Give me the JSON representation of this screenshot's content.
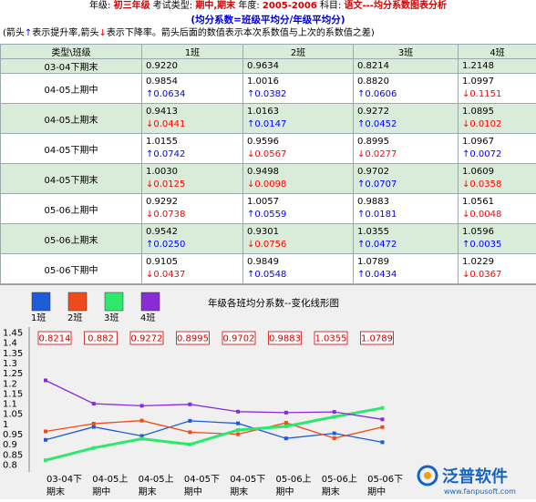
{
  "header": {
    "grade_label": "年级:",
    "grade_value": "初三年级",
    "exam_type_label": "考试类型:",
    "exam_type_value": "期中,期末",
    "year_label": "年度:",
    "year_value": "2005-2006",
    "subject_label": "科目:",
    "subject_value": "语文---均分系数图表分析",
    "formula": "(均分系数=班级平均分/年级平均分)",
    "legend_prefix": "(箭头",
    "legend_up": "↑",
    "legend_up_text": "表示提升率,箭头",
    "legend_down": "↓",
    "legend_down_text": "表示下降率。箭头后面的数值表示本次系数值与上次的系数值之差)"
  },
  "table": {
    "headers": [
      "类型\\班级",
      "1班",
      "2班",
      "3班",
      "4班"
    ],
    "rows": [
      {
        "type": "03-04下期末",
        "cells": [
          {
            "v": "0.9220"
          },
          {
            "v": "0.9634"
          },
          {
            "v": "0.8214"
          },
          {
            "v": "1.2148"
          }
        ]
      },
      {
        "type": "04-05上期中",
        "cells": [
          {
            "v": "0.9854",
            "a": "↑",
            "d": "0.0634"
          },
          {
            "v": "1.0016",
            "a": "↑",
            "d": "0.0382"
          },
          {
            "v": "0.8820",
            "a": "↑",
            "d": "0.0606"
          },
          {
            "v": "1.0997",
            "a": "↓",
            "d": "0.1151"
          }
        ]
      },
      {
        "type": "04-05上期末",
        "cells": [
          {
            "v": "0.9413",
            "a": "↓",
            "d": "0.0441"
          },
          {
            "v": "1.0163",
            "a": "↑",
            "d": "0.0147"
          },
          {
            "v": "0.9272",
            "a": "↑",
            "d": "0.0452"
          },
          {
            "v": "1.0895",
            "a": "↓",
            "d": "0.0102"
          }
        ]
      },
      {
        "type": "04-05下期中",
        "cells": [
          {
            "v": "1.0155",
            "a": "↑",
            "d": "0.0742"
          },
          {
            "v": "0.9596",
            "a": "↓",
            "d": "0.0567"
          },
          {
            "v": "0.8995",
            "a": "↓",
            "d": "0.0277"
          },
          {
            "v": "1.0967",
            "a": "↑",
            "d": "0.0072"
          }
        ]
      },
      {
        "type": "04-05下期末",
        "cells": [
          {
            "v": "1.0030",
            "a": "↓",
            "d": "0.0125"
          },
          {
            "v": "0.9498",
            "a": "↓",
            "d": "0.0098"
          },
          {
            "v": "0.9702",
            "a": "↑",
            "d": "0.0707"
          },
          {
            "v": "1.0609",
            "a": "↓",
            "d": "0.0358"
          }
        ]
      },
      {
        "type": "05-06上期中",
        "cells": [
          {
            "v": "0.9292",
            "a": "↓",
            "d": "0.0738"
          },
          {
            "v": "1.0057",
            "a": "↑",
            "d": "0.0559"
          },
          {
            "v": "0.9883",
            "a": "↑",
            "d": "0.0181"
          },
          {
            "v": "1.0561",
            "a": "↓",
            "d": "0.0048"
          }
        ]
      },
      {
        "type": "05-06上期末",
        "cells": [
          {
            "v": "0.9542",
            "a": "↑",
            "d": "0.0250"
          },
          {
            "v": "0.9301",
            "a": "↓",
            "d": "0.0756"
          },
          {
            "v": "1.0355",
            "a": "↑",
            "d": "0.0472"
          },
          {
            "v": "1.0596",
            "a": "↑",
            "d": "0.0035"
          }
        ]
      },
      {
        "type": "05-06下期中",
        "cells": [
          {
            "v": "0.9105",
            "a": "↓",
            "d": "0.0437"
          },
          {
            "v": "0.9849",
            "a": "↑",
            "d": "0.0548"
          },
          {
            "v": "1.0789",
            "a": "↑",
            "d": "0.0434"
          },
          {
            "v": "1.0229",
            "a": "↓",
            "d": "0.0367"
          }
        ]
      }
    ]
  },
  "chart_data": {
    "type": "line",
    "title": "年级各班均分系数--变化线形图",
    "x": [
      "03-04下期末",
      "04-05上期中",
      "04-05上期末",
      "04-05下期中",
      "04-05下期末",
      "05-06上期中",
      "05-06上期末",
      "05-06下期中"
    ],
    "x_tick_labels": [
      [
        "03-04下",
        "期末"
      ],
      [
        "04-05上",
        "期中"
      ],
      [
        "04-05上",
        "期末"
      ],
      [
        "04-05下",
        "期中"
      ],
      [
        "04-05下",
        "期末"
      ],
      [
        "05-06上",
        "期中"
      ],
      [
        "05-06上",
        "期末"
      ],
      [
        "05-06下",
        "期中"
      ]
    ],
    "ylim": [
      0.8,
      1.45
    ],
    "y_ticks": [
      "1.45",
      "1.4",
      "1.35",
      "1.3",
      "1.25",
      "1.2",
      "1.15",
      "1.1",
      "1.05",
      "1",
      "0.95",
      "0.9",
      "0.85",
      "0.8"
    ],
    "legend_placement": "top-left",
    "series": [
      {
        "name": "1班",
        "color": "#1e5bd8",
        "values": [
          0.922,
          0.9854,
          0.9413,
          1.0155,
          1.003,
          0.9292,
          0.9542,
          0.9105
        ]
      },
      {
        "name": "2班",
        "color": "#f04a1a",
        "values": [
          0.9634,
          1.0016,
          1.0163,
          0.9596,
          0.9498,
          1.0057,
          0.9301,
          0.9849
        ]
      },
      {
        "name": "3班",
        "color": "#2ee86e",
        "values": [
          0.8214,
          0.882,
          0.9272,
          0.8995,
          0.9702,
          0.9883,
          1.0355,
          1.0789
        ]
      },
      {
        "name": "4班",
        "color": "#8a2bd8",
        "values": [
          1.2148,
          1.0997,
          1.0895,
          1.0967,
          1.0609,
          1.0561,
          1.0596,
          1.0229
        ]
      }
    ],
    "highlight_series_index": 2,
    "value_labels": [
      "0.8214",
      "0.882",
      "0.9272",
      "0.8995",
      "0.9702",
      "0.9883",
      "1.0355",
      "1.0789"
    ],
    "value_label_color": "#d00000"
  },
  "logo": {
    "brand_text": "泛普软件",
    "url_text": "www.fanpusoft.com",
    "color": "#1565c0"
  }
}
